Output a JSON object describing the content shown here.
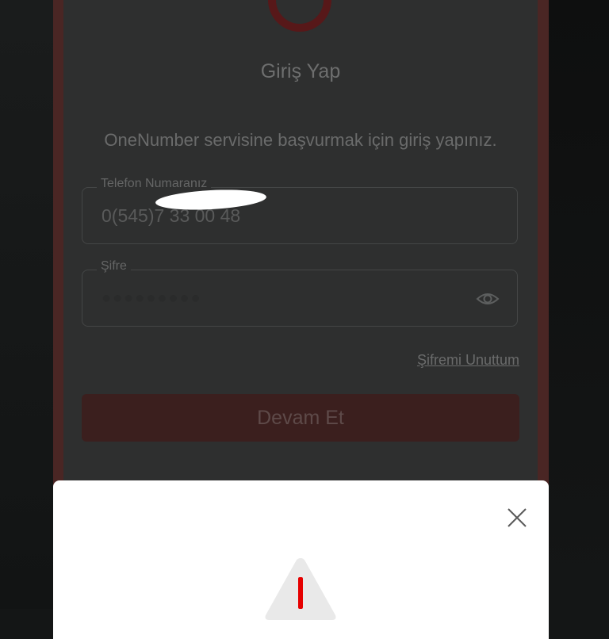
{
  "login": {
    "title": "Giriş Yap",
    "subtitle": "OneNumber servisine başvurmak için giriş yapınız.",
    "phone_label": "Telefon Numaranız",
    "phone_value": "0(545)7 33 00 48",
    "password_label": "Şifre",
    "password_value": "●●●●●●●●●",
    "forgot_link": "Şifremi Unuttum",
    "continue_button": "Devam Et"
  },
  "modal": {
    "close_icon": "close-icon",
    "status_icon": "warning-icon"
  },
  "colors": {
    "brand_red": "#e60000",
    "overlay_bg": "#2e2f2f",
    "modal_bg": "#ffffff"
  }
}
